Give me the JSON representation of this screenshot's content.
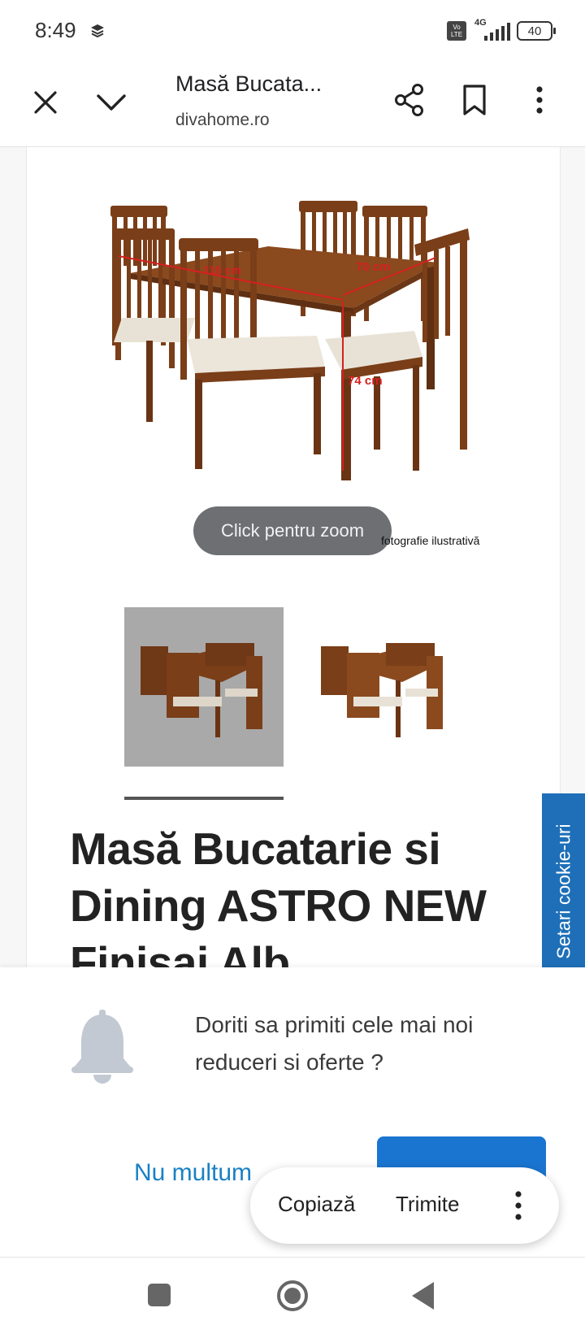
{
  "status_bar": {
    "time": "8:49",
    "network": "4G",
    "volte": "Vo LTE",
    "battery": "40"
  },
  "toolbar": {
    "title": "Masă Bucata...",
    "url": "divahome.ro",
    "icons": [
      "close-icon",
      "chevron-down-icon",
      "share-icon",
      "bookmark-icon",
      "more-vert-icon"
    ]
  },
  "product": {
    "image_labels": {
      "length": "110 cm",
      "width": "70 cm",
      "height": "74 cm"
    },
    "zoom_hint": "Click pentru zoom",
    "image_caption": "fotografie ilustrativă",
    "title_line1": "Masă Bucatarie si",
    "title_line2": "Dining ASTRO NEW",
    "title_line3": "Finisaj Alb"
  },
  "cookie_tab": {
    "label": "Setari cookie-uri",
    "icon": "star-icon"
  },
  "notification_prompt": {
    "message": "Doriti sa primiti cele mai noi reduceri si oferte ?",
    "decline_label": "Nu multum",
    "accept_label": ""
  },
  "selection_menu": {
    "copy_label": "Copiază",
    "send_label": "Trimite"
  },
  "nav_bar": {
    "icons": [
      "recents-square-icon",
      "home-circle-icon",
      "back-triangle-icon"
    ]
  },
  "colors": {
    "accent": "#1a75d1",
    "cookie_tab": "#1e6fb8",
    "wood": "#7a3e18",
    "cushion": "#e8e2d6",
    "dimension_lines": "#d62020"
  }
}
